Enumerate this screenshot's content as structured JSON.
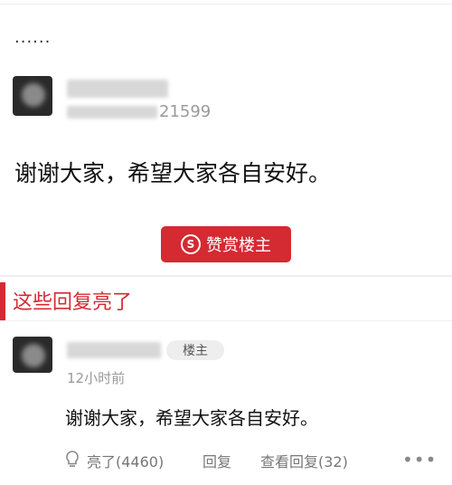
{
  "header": {
    "ellipsis": "······"
  },
  "post": {
    "user_id_fragment": "21599",
    "text": "谢谢大家，希望大家各自安好。",
    "reward_button": "赞赏楼主",
    "reward_icon": "S"
  },
  "section": {
    "title": "这些回复亮了"
  },
  "reply": {
    "badge": "楼主",
    "time": "12小时前",
    "text": "谢谢大家，希望大家各自安好。",
    "like_label": "亮了(4460)",
    "reply_label": "回复",
    "view_replies_label": "查看回复(32)",
    "more": "•••"
  },
  "colors": {
    "accent": "#d42a32",
    "divider": "#eeeeee"
  }
}
